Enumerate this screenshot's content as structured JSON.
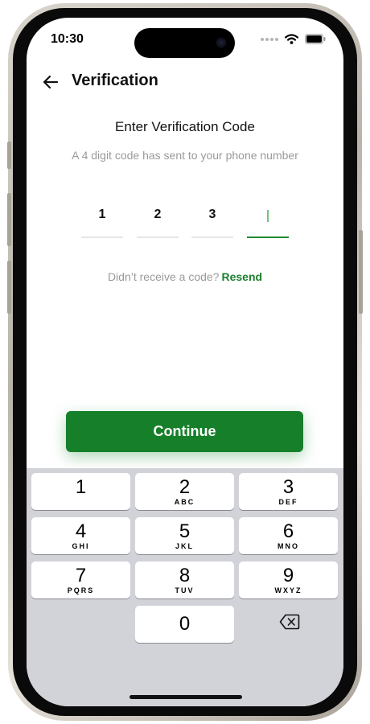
{
  "status_bar": {
    "time": "10:30"
  },
  "header": {
    "title": "Verification"
  },
  "content": {
    "heading": "Enter Verification Code",
    "subheading": "A 4 digit code has sent to your phone number",
    "otp_digits": [
      "1",
      "2",
      "3",
      ""
    ],
    "resend_prompt": "Didn’t receive a code?",
    "resend_link": "Resend",
    "continue_label": "Continue"
  },
  "keypad": {
    "keys": [
      {
        "num": "1",
        "letters": ""
      },
      {
        "num": "2",
        "letters": "ABC"
      },
      {
        "num": "3",
        "letters": "DEF"
      },
      {
        "num": "4",
        "letters": "GHI"
      },
      {
        "num": "5",
        "letters": "JKL"
      },
      {
        "num": "6",
        "letters": "MNO"
      },
      {
        "num": "7",
        "letters": "PQRS"
      },
      {
        "num": "8",
        "letters": "TUV"
      },
      {
        "num": "9",
        "letters": "WXYZ"
      },
      {
        "num": "0",
        "letters": ""
      }
    ]
  },
  "colors": {
    "accent": "#167f2a",
    "keypad_bg": "#d1d3d9",
    "muted_text": "#9a9a9a"
  },
  "icons": [
    "back-arrow-icon",
    "wifi-icon",
    "battery-icon",
    "backspace-icon"
  ]
}
